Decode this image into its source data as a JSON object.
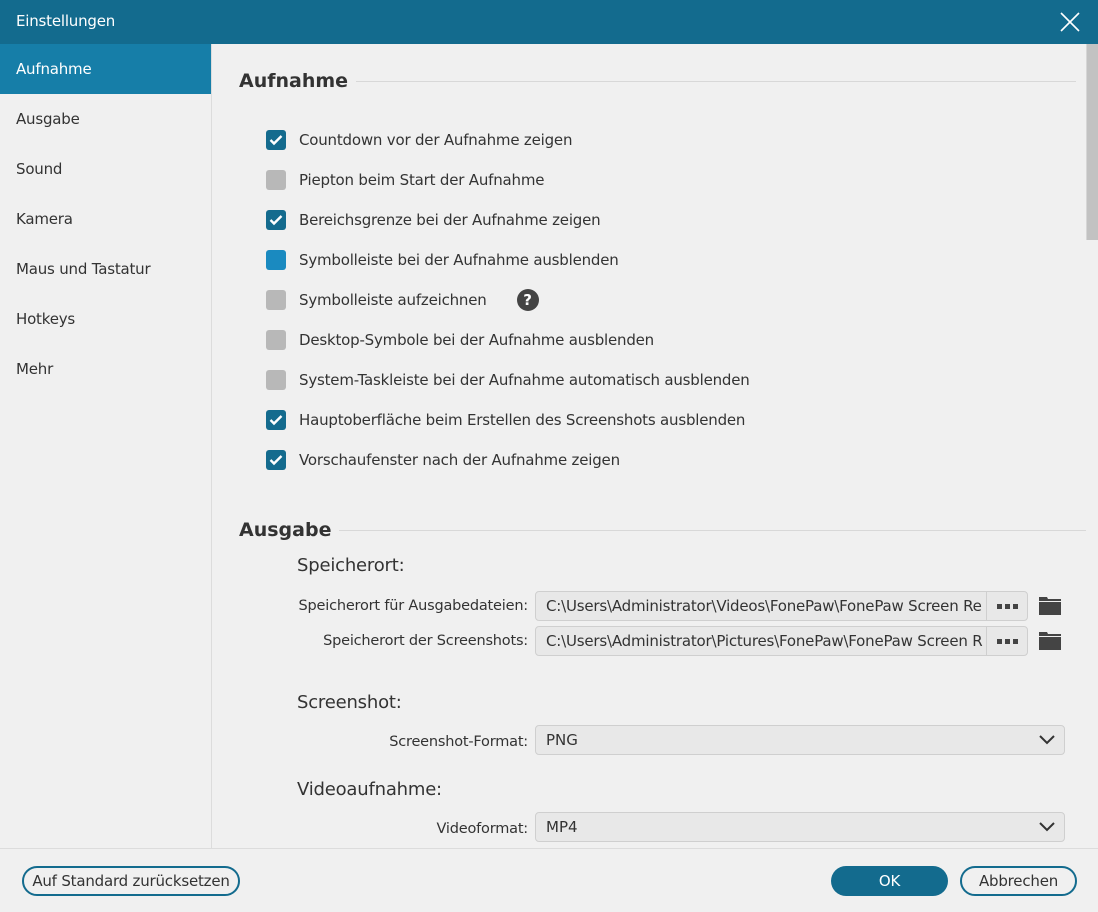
{
  "window": {
    "title": "Einstellungen"
  },
  "sidebar": {
    "items": [
      {
        "label": "Aufnahme",
        "active": true
      },
      {
        "label": "Ausgabe"
      },
      {
        "label": "Sound"
      },
      {
        "label": "Kamera"
      },
      {
        "label": "Maus und Tastatur"
      },
      {
        "label": "Hotkeys"
      },
      {
        "label": "Mehr"
      }
    ]
  },
  "recording": {
    "heading": "Aufnahme",
    "options": [
      {
        "label": "Countdown vor der Aufnahme zeigen",
        "checked": true
      },
      {
        "label": "Piepton beim Start der Aufnahme",
        "checked": false
      },
      {
        "label": "Bereichsgrenze bei der Aufnahme zeigen",
        "checked": true
      },
      {
        "label": "Symbolleiste bei der Aufnahme ausblenden",
        "checked": false,
        "hovered": true
      },
      {
        "label": "Symbolleiste aufzeichnen",
        "checked": false,
        "help": "?"
      },
      {
        "label": "Desktop-Symbole bei der Aufnahme ausblenden",
        "checked": false
      },
      {
        "label": "System-Taskleiste bei der Aufnahme automatisch ausblenden",
        "checked": false
      },
      {
        "label": "Hauptoberfläche beim Erstellen des Screenshots ausblenden",
        "checked": true
      },
      {
        "label": "Vorschaufenster nach der Aufnahme zeigen",
        "checked": true
      }
    ]
  },
  "output": {
    "heading": "Ausgabe",
    "location": {
      "heading": "Speicherort:",
      "output_files_label": "Speicherort für Ausgabedateien:",
      "output_files_value": "C:\\Users\\Administrator\\Videos\\FonePaw\\FonePaw Screen Re",
      "screenshots_label": "Speicherort der Screenshots:",
      "screenshots_value": "C:\\Users\\Administrator\\Pictures\\FonePaw\\FonePaw Screen R"
    },
    "screenshot": {
      "heading": "Screenshot:",
      "format_label": "Screenshot-Format:",
      "format_value": "PNG"
    },
    "video": {
      "heading": "Videoaufnahme:",
      "format_label": "Videoformat:",
      "format_value": "MP4"
    }
  },
  "footer": {
    "reset_label": "Auf Standard zurücksetzen",
    "ok_label": "OK",
    "cancel_label": "Abbrechen"
  },
  "colors": {
    "accent": "#136b8e",
    "sidebar_active": "#167ea8",
    "checkbox_hover": "#1a8ac0",
    "checkbox_unchecked": "#b8b8b8"
  }
}
